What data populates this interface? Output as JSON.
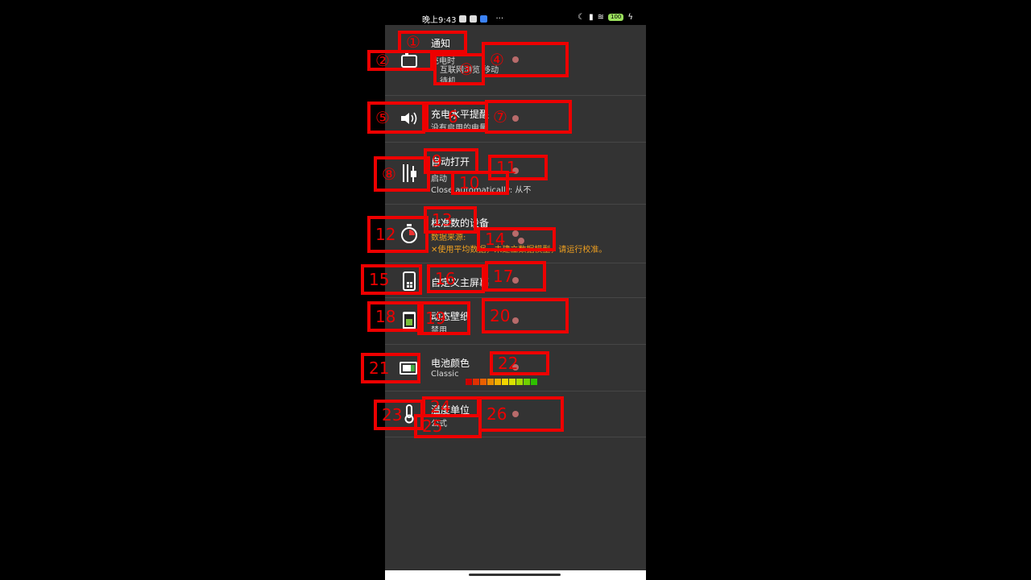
{
  "status_bar": {
    "time": "晚上9:43",
    "more": "···",
    "battery": "100"
  },
  "settings": [
    {
      "id": "notice",
      "title": "通知",
      "subtitle": "充电时",
      "subtitle2": "互联网浏览 移动",
      "subtitle3": "待机",
      "icon": "notification-icon"
    },
    {
      "id": "charge-alert",
      "title": "充电水平提醒",
      "subtitle": "没有启用的电量",
      "icon": "speaker-icon"
    },
    {
      "id": "auto-open",
      "title": "自动打开",
      "subtitle": "启动",
      "subtitle2": "Close automatically: 从不",
      "icon": "plug-icon"
    },
    {
      "id": "calibrated",
      "title": "校准数的设备",
      "subtitle": "数据来源:",
      "subtitle2": "✕使用平均数据，未建立数据模型，请运行校准。",
      "icon": "stopwatch-icon"
    },
    {
      "id": "home-widget",
      "title": "自定义主屏幕",
      "icon": "phone-widget-icon"
    },
    {
      "id": "live-wallpaper",
      "title": "动态壁纸",
      "subtitle": "禁用",
      "icon": "wallpaper-icon"
    },
    {
      "id": "battery-color",
      "title": "电池颜色",
      "subtitle": "Classic",
      "icon": "battery-icon"
    },
    {
      "id": "temp-unit",
      "title": "温度单位",
      "subtitle": "公式",
      "icon": "thermometer-icon"
    }
  ],
  "battery_palette": [
    "#cc0000",
    "#e03000",
    "#e86000",
    "#ea8c00",
    "#f2b000",
    "#f2d400",
    "#d8e000",
    "#a8d800",
    "#70d000",
    "#2ec000"
  ],
  "annotations": [
    "①",
    "②",
    "③",
    "④",
    "⑤",
    "6",
    "⑦",
    "⑧",
    "9",
    "10",
    "11",
    "12",
    "13",
    "14",
    "15",
    "16",
    "17",
    "18",
    "19",
    "20",
    "21",
    "22",
    "23",
    "24",
    "25",
    "26"
  ]
}
